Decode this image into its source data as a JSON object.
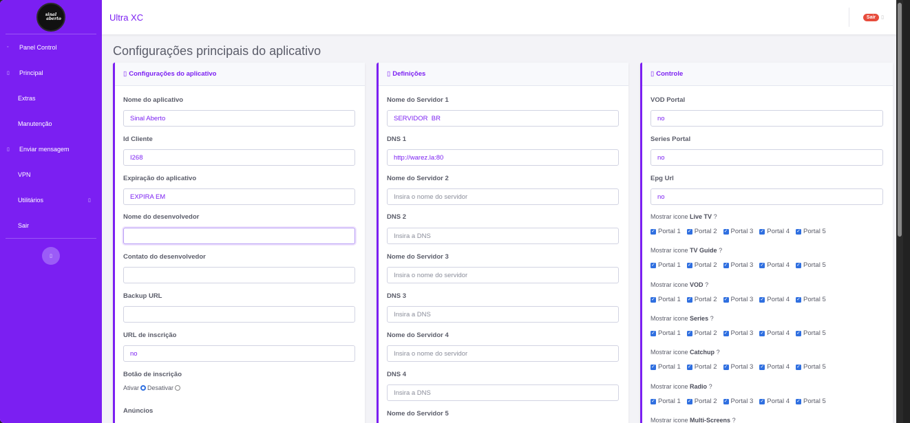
{
  "sidebar": {
    "logo_text_1": "sinal",
    "logo_text_2": "aberto",
    "items": [
      {
        "icon": "◦",
        "label": "Panel Control"
      },
      {
        "icon": "▯",
        "label": "Principal"
      },
      {
        "label": "Extras"
      },
      {
        "label": "Manutenção"
      },
      {
        "icon": "▯",
        "label": "Enviar mensagem"
      },
      {
        "label": "VPN"
      },
      {
        "label": "Utilitários",
        "caret": "▯"
      },
      {
        "label": "Sair"
      }
    ],
    "toggle_icon": "▯"
  },
  "topbar": {
    "app_title": "Ultra XC",
    "logout_label": "Sair",
    "logout_icon": "▯"
  },
  "page_title": "Configurações principais do aplicativo",
  "cards": {
    "app": {
      "icon": "▯",
      "title": "Configurações do aplicativo",
      "fields": {
        "app_name": {
          "label": "Nome do aplicativo",
          "value": "Sinal Aberto"
        },
        "client_id": {
          "label": "Id Cliente",
          "value": "I268"
        },
        "expiration": {
          "label": "Expiração do aplicativo",
          "value": "EXPIRA EM"
        },
        "developer_name": {
          "label": "Nome do desenvolvedor",
          "value": ""
        },
        "developer_contact": {
          "label": "Contato do desenvolvedor",
          "value": ""
        },
        "backup_url": {
          "label": "Backup URL",
          "value": ""
        },
        "signup_url": {
          "label": "URL de inscrição",
          "value": "no"
        }
      },
      "signup_button": {
        "label": "Botão de inscrição",
        "on_label": "Ativar",
        "off_label": "Desativar",
        "selected": "Ativar"
      },
      "ads_label": "Anúncios"
    },
    "defs": {
      "icon": "▯",
      "title": "Definições",
      "fields": {
        "server1": {
          "label": "Nome do Servidor 1",
          "value": "SERVIDOR  BR",
          "placeholder": ""
        },
        "dns1": {
          "label": "DNS 1",
          "value": "http://warez.la:80",
          "placeholder": ""
        },
        "server2": {
          "label": "Nome do Servidor 2",
          "value": "",
          "placeholder": "Insira o nome do servidor"
        },
        "dns2": {
          "label": "DNS 2",
          "value": "",
          "placeholder": "Insira a DNS"
        },
        "server3": {
          "label": "Nome do Servidor 3",
          "value": "",
          "placeholder": "Insira o nome do servidor"
        },
        "dns3": {
          "label": "DNS 3",
          "value": "",
          "placeholder": "Insira a DNS"
        },
        "server4": {
          "label": "Nome do Servidor 4",
          "value": "",
          "placeholder": "Insira o nome do servidor"
        },
        "dns4": {
          "label": "DNS 4",
          "value": "",
          "placeholder": "Insira a DNS"
        },
        "server5": {
          "label": "Nome do Servidor 5"
        }
      }
    },
    "control": {
      "icon": "▯",
      "title": "Controle",
      "fields": {
        "vod_portal": {
          "label": "VOD Portal",
          "value": "no"
        },
        "series_portal": {
          "label": "Series Portal",
          "value": "no"
        },
        "epg_url": {
          "label": "Epg Url",
          "value": "no"
        }
      },
      "show_prefix": "Mostrar icone",
      "suffix": "?",
      "groups": [
        {
          "name": "Live TV"
        },
        {
          "name": "TV Guide"
        },
        {
          "name": "VOD"
        },
        {
          "name": "Series"
        },
        {
          "name": "Catchup"
        },
        {
          "name": "Radio"
        },
        {
          "name": "Multi-Screens"
        }
      ],
      "portals": [
        "Portal 1",
        "Portal 2",
        "Portal 3",
        "Portal 4",
        "Portal 5"
      ],
      "checkmark": "✓"
    }
  },
  "colors": {
    "accent": "#7b1ff2",
    "checkbox": "#2f6fe0",
    "logout": "#e74c3c"
  }
}
